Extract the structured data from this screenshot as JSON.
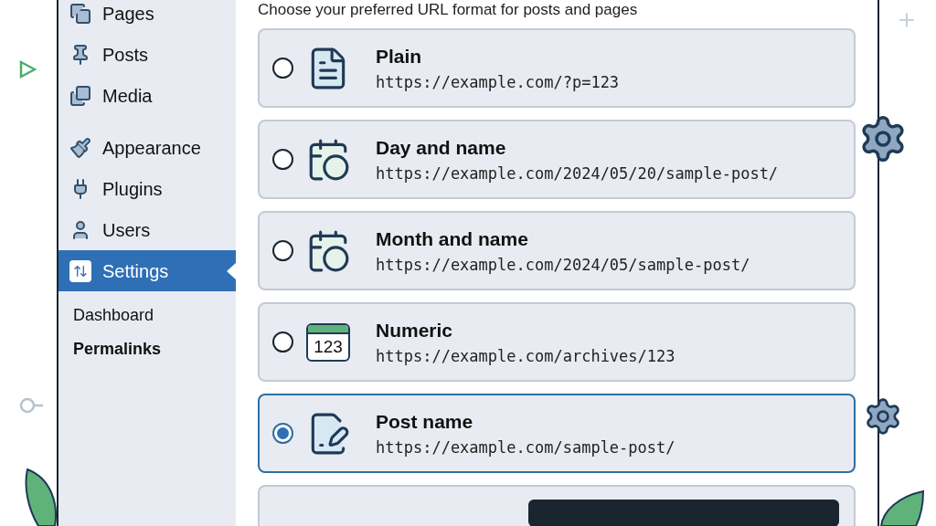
{
  "sidebar": {
    "menu": [
      {
        "label": "Pages",
        "selected": false
      },
      {
        "label": "Posts",
        "selected": false
      },
      {
        "label": "Media",
        "selected": false
      },
      {
        "label": "Appearance",
        "selected": false
      },
      {
        "label": "Plugins",
        "selected": false
      },
      {
        "label": "Users",
        "selected": false
      },
      {
        "label": "Settings",
        "selected": true
      }
    ],
    "submenu": [
      {
        "label": "Dashboard",
        "selected": false
      },
      {
        "label": "Permalinks",
        "selected": true
      }
    ]
  },
  "main": {
    "intro": "Choose your preferred URL format for posts and pages",
    "options": [
      {
        "title": "Plain",
        "url": "https://example.com/?p=123",
        "selected": false
      },
      {
        "title": "Day and name",
        "url": "https://example.com/2024/05/20/sample-post/",
        "selected": false
      },
      {
        "title": "Month and name",
        "url": "https://example.com/2024/05/sample-post/",
        "selected": false
      },
      {
        "title": "Numeric",
        "url": "https://example.com/archives/123",
        "icon_text": "123",
        "selected": false
      },
      {
        "title": "Post name",
        "url": "https://example.com/sample-post/",
        "selected": true
      }
    ]
  }
}
